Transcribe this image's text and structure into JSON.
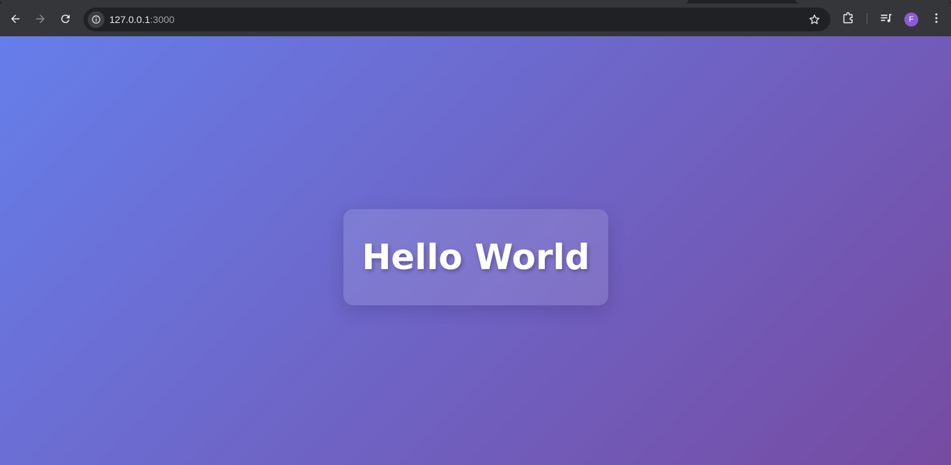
{
  "browser": {
    "url_host": "127.0.0.1",
    "url_port": ":3000",
    "profile_initial": "F"
  },
  "icons": {
    "back": "back-arrow-icon",
    "forward": "forward-arrow-icon",
    "reload": "reload-icon",
    "site_info": "info-icon",
    "bookmark": "star-icon",
    "extensions": "puzzle-icon",
    "media": "media-queue-icon",
    "menu": "kebab-menu-icon"
  },
  "page": {
    "heading": "Hello World",
    "gradient_start": "#667eea",
    "gradient_end": "#764ba2"
  }
}
